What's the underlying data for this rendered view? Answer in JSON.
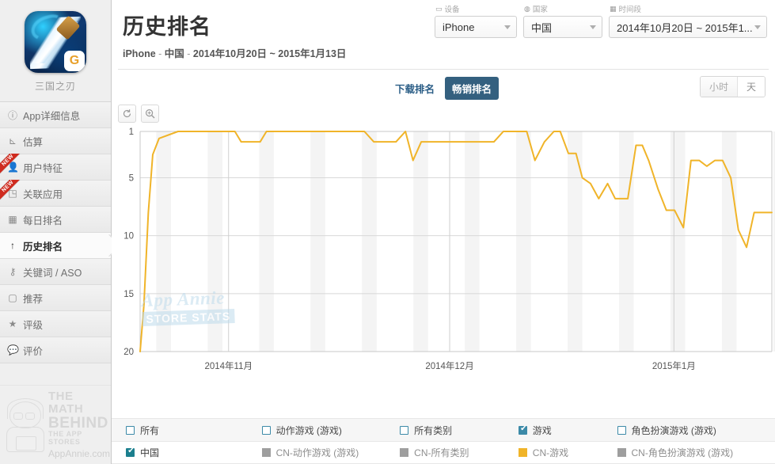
{
  "sidebar": {
    "app_name": "三国之刃",
    "app_icon": "sword-dragon-app-icon",
    "items": [
      {
        "label": "App详细信息",
        "icon": "info-icon",
        "active": false,
        "badge": ""
      },
      {
        "label": "估算",
        "icon": "chart-icon",
        "active": false,
        "badge": ""
      },
      {
        "label": "用户特征",
        "icon": "person-icon",
        "active": false,
        "badge": "NEW"
      },
      {
        "label": "关联应用",
        "icon": "apps-icon",
        "active": false,
        "badge": "NEW"
      },
      {
        "label": "每日排名",
        "icon": "calendar-icon",
        "active": false,
        "badge": ""
      },
      {
        "label": "历史排名",
        "icon": "arrow-up-icon",
        "active": true,
        "badge": ""
      },
      {
        "label": "关键词 / ASO",
        "icon": "key-icon",
        "active": false,
        "badge": ""
      },
      {
        "label": "推荐",
        "icon": "book-icon",
        "active": false,
        "badge": ""
      },
      {
        "label": "评级",
        "icon": "star-icon",
        "active": false,
        "badge": ""
      },
      {
        "label": "评价",
        "icon": "comment-icon",
        "active": false,
        "badge": ""
      }
    ],
    "footer": {
      "line1": "THE MATH",
      "line2": "BEHIND",
      "line3": "THE APP STORES",
      "line4": "AppAnnie.com",
      "mascot": "girl-with-tablet-mascot"
    }
  },
  "header": {
    "title": "历史排名",
    "subtitle_device": "iPhone",
    "subtitle_country": "中国",
    "subtitle_range": "2014年10月20日 ~ 2015年1月13日",
    "separator": " - "
  },
  "filters": [
    {
      "label": "设备",
      "icon": "device-icon",
      "value": "iPhone",
      "name": "device-select"
    },
    {
      "label": "国家",
      "icon": "globe-icon",
      "value": "中国",
      "name": "country-select"
    },
    {
      "label": "时间段",
      "icon": "calendar-icon",
      "value": "2014年10月20日 ~ 2015年1...",
      "name": "date-range-select"
    }
  ],
  "tabs": [
    {
      "label": "下载排名",
      "active": false
    },
    {
      "label": "畅销排名",
      "active": true
    }
  ],
  "granularity": [
    {
      "label": "小时",
      "active": false
    },
    {
      "label": "天",
      "active": true
    }
  ],
  "chart_tools": [
    {
      "icon": "reset-zoom-icon",
      "name": "reset-button"
    },
    {
      "icon": "zoom-in-icon",
      "name": "zoom-button"
    }
  ],
  "watermark": {
    "line1": "App Annie",
    "line2": "STORE STATS"
  },
  "colors": {
    "series_gold": "#f0b429",
    "accent_teal": "#1b7f8e",
    "tab_active_bg": "#34607f",
    "grid": "#d8d8d8"
  },
  "chart_data": {
    "type": "line",
    "title": "",
    "xlabel": "",
    "ylabel": "",
    "ylim": [
      1,
      20
    ],
    "y_inverted": true,
    "yticks": [
      1,
      5,
      10,
      15,
      20
    ],
    "xticks": [
      "2014年11月",
      "2014年12月",
      "2015年1月"
    ],
    "xtick_positions": [
      0.14,
      0.49,
      0.845
    ],
    "grid": true,
    "legend_position": "bottom",
    "series": [
      {
        "name": "CN-游戏",
        "color": "#f0b429",
        "x": [
          0.0,
          0.006,
          0.013,
          0.02,
          0.03,
          0.06,
          0.09,
          0.14,
          0.15,
          0.16,
          0.175,
          0.19,
          0.2,
          0.215,
          0.23,
          0.34,
          0.355,
          0.37,
          0.39,
          0.405,
          0.42,
          0.432,
          0.445,
          0.46,
          0.47,
          0.49,
          0.505,
          0.56,
          0.575,
          0.59,
          0.6,
          0.612,
          0.625,
          0.64,
          0.655,
          0.665,
          0.678,
          0.69,
          0.7,
          0.713,
          0.726,
          0.74,
          0.752,
          0.76,
          0.772,
          0.785,
          0.795,
          0.805,
          0.82,
          0.833,
          0.846,
          0.86,
          0.872,
          0.885,
          0.897,
          0.91,
          0.922,
          0.935,
          0.947,
          0.96,
          0.972,
          0.985,
          1.0
        ],
        "y": [
          20.0,
          16.0,
          8.0,
          3.0,
          1.6,
          1.0,
          1.0,
          1.0,
          1.0,
          1.9,
          1.9,
          1.9,
          1.0,
          1.0,
          1.0,
          1.0,
          1.0,
          1.9,
          1.9,
          1.9,
          1.0,
          3.5,
          1.9,
          1.9,
          1.9,
          1.9,
          1.9,
          1.9,
          1.0,
          1.0,
          1.0,
          1.0,
          3.5,
          1.9,
          1.0,
          1.0,
          2.9,
          2.9,
          5.0,
          5.5,
          6.8,
          5.5,
          6.8,
          6.8,
          6.8,
          2.2,
          2.2,
          3.5,
          6.0,
          7.8,
          7.8,
          9.3,
          3.5,
          3.5,
          4.0,
          3.5,
          3.5,
          5.0,
          9.5,
          11.0,
          8.0,
          8.0,
          8.0
        ],
        "description": "中国 iPhone 畅销排名 (游戏分类) 时间序列, 排名1为最佳"
      }
    ],
    "series_notes": "单一可见折线: CN-游戏 (金色). 起点在第20名附近, 迅速升至第1名, 多数期间保持1-2名, 12月中旬后波动下滑至5-11名区间."
  },
  "legend": {
    "rows": [
      {
        "type": "checkbox",
        "items": [
          {
            "label": "所有",
            "checked": false
          },
          {
            "label": "动作游戏 (游戏)",
            "checked": false
          },
          {
            "label": "所有类别",
            "checked": false
          },
          {
            "label": "游戏",
            "checked": true
          },
          {
            "label": "角色扮演游戏 (游戏)",
            "checked": false
          }
        ]
      },
      {
        "type": "series",
        "items": [
          {
            "label": "中国",
            "swatch": "teal",
            "checked": true
          },
          {
            "label": "CN-动作游戏 (游戏)",
            "swatch": "grey",
            "checked": false
          },
          {
            "label": "CN-所有类别",
            "swatch": "grey",
            "checked": false
          },
          {
            "label": "CN-游戏",
            "swatch": "gold",
            "checked": false
          },
          {
            "label": "CN-角色扮演游戏 (游戏)",
            "swatch": "grey",
            "checked": false
          }
        ]
      }
    ]
  }
}
